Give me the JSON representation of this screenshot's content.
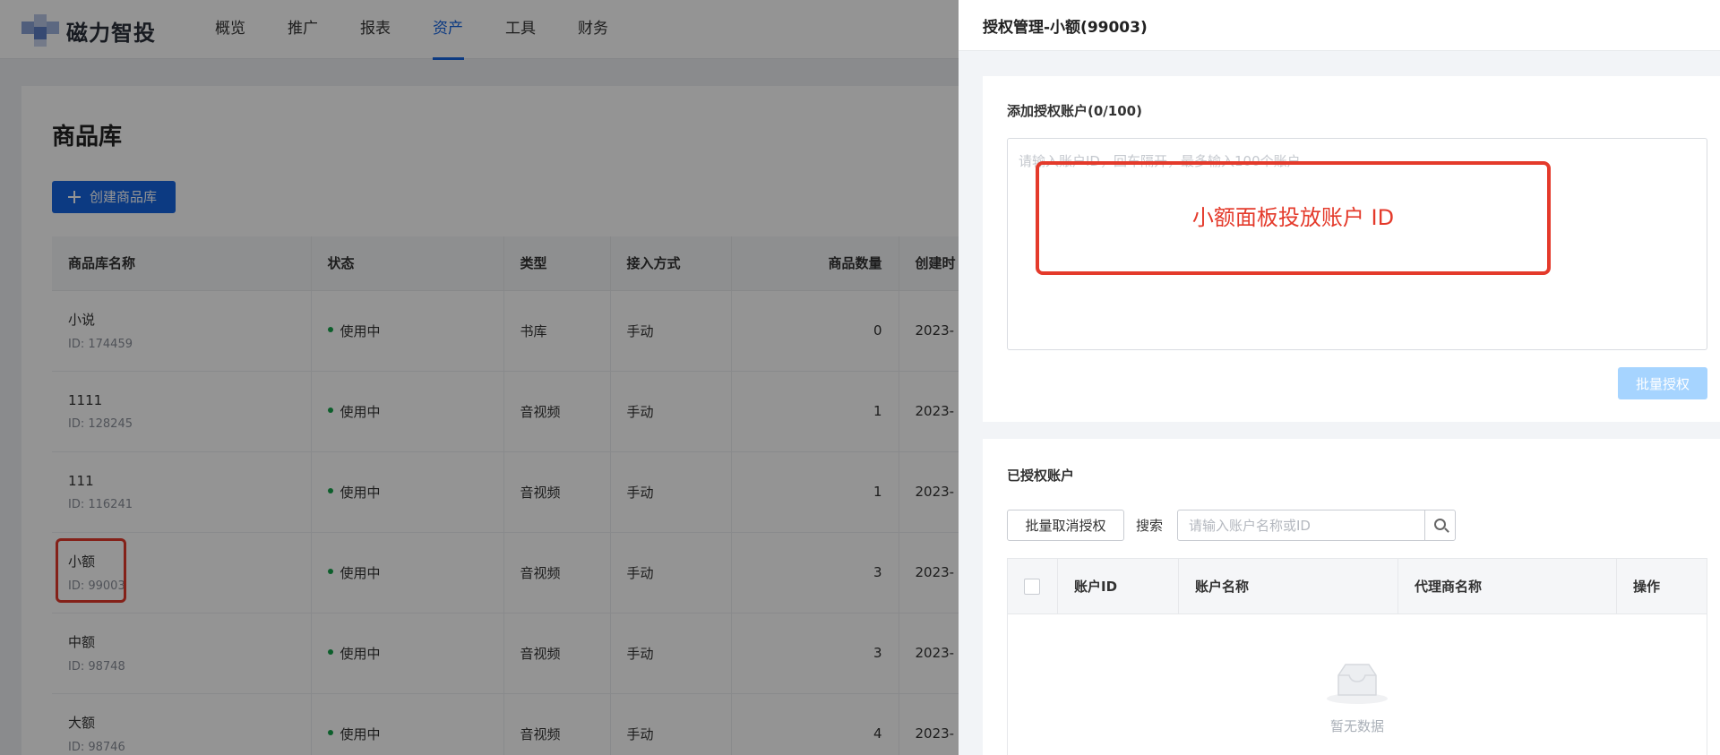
{
  "app": {
    "brand": "磁力智投",
    "nav": [
      "概览",
      "推广",
      "报表",
      "资产",
      "工具",
      "财务"
    ],
    "active_nav": "资产"
  },
  "page": {
    "title": "商品库",
    "create_button": "创建商品库",
    "columns": [
      "商品库名称",
      "状态",
      "类型",
      "接入方式",
      "商品数量",
      "创建时"
    ],
    "rows": [
      {
        "name": "小说",
        "id": "ID: 174459",
        "status": "使用中",
        "type": "书库",
        "access": "手动",
        "count": "0",
        "created": "2023-"
      },
      {
        "name": "1111",
        "id": "ID: 128245",
        "status": "使用中",
        "type": "音视频",
        "access": "手动",
        "count": "1",
        "created": "2023-"
      },
      {
        "name": "111",
        "id": "ID: 116241",
        "status": "使用中",
        "type": "音视频",
        "access": "手动",
        "count": "1",
        "created": "2023-"
      },
      {
        "name": "小额",
        "id": "ID: 99003",
        "status": "使用中",
        "type": "音视频",
        "access": "手动",
        "count": "3",
        "created": "2023-"
      },
      {
        "name": "中额",
        "id": "ID: 98748",
        "status": "使用中",
        "type": "音视频",
        "access": "手动",
        "count": "3",
        "created": "2023-"
      },
      {
        "name": "大额",
        "id": "ID: 98746",
        "status": "使用中",
        "type": "音视频",
        "access": "手动",
        "count": "4",
        "created": "2023-"
      }
    ]
  },
  "drawer": {
    "title": "授权管理-小额(99003)",
    "add_section_label": "添加授权账户(0/100)",
    "textarea_placeholder": "请输入账户ID，回车隔开，最多输入100个账户",
    "annotation": "小额面板投放账户 ID",
    "batch_authorize": "批量授权",
    "authorized_label": "已授权账户",
    "batch_revoke": "批量取消授权",
    "search_label": "搜索",
    "search_placeholder": "请输入账户名称或ID",
    "table_columns": [
      "账户ID",
      "账户名称",
      "代理商名称",
      "操作"
    ],
    "empty_text": "暂无数据"
  },
  "colors": {
    "primary": "#1664e0",
    "annotation_red": "#e43a2b",
    "status_green": "#15a34a",
    "disabled_button": "#a6d4ff"
  },
  "icons": [
    "plus-icon",
    "status-dot-icon",
    "search-icon",
    "empty-inbox-icon",
    "brand-logo-icon"
  ]
}
